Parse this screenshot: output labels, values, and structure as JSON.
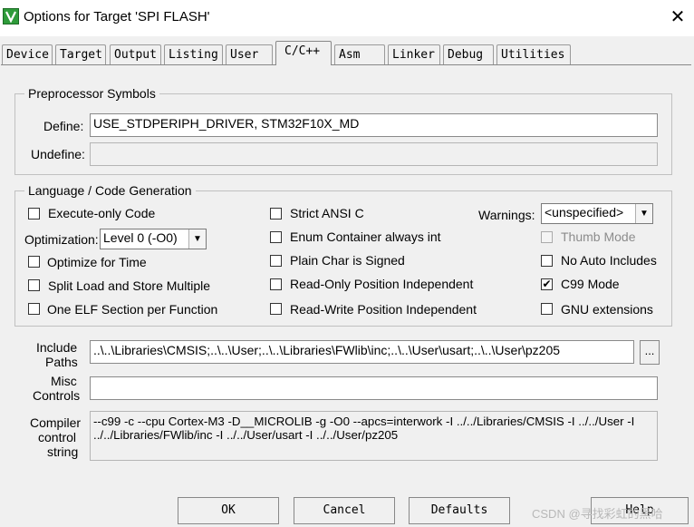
{
  "window": {
    "title": "Options for Target 'SPI FLASH'",
    "close_glyph": "✕",
    "icon": "keil-vision-icon"
  },
  "tabs": [
    "Device",
    "Target",
    "Output",
    "Listing",
    "User",
    "C/C++",
    "Asm",
    "Linker",
    "Debug",
    "Utilities"
  ],
  "active_tab": "C/C++",
  "preprocessor": {
    "group_label": "Preprocessor Symbols",
    "define_label": "Define:",
    "define_value": "USE_STDPERIPH_DRIVER, STM32F10X_MD",
    "undefine_label": "Undefine:",
    "undefine_value": ""
  },
  "codegen": {
    "group_label": "Language / Code Generation",
    "execute_only": {
      "label": "Execute-only Code",
      "checked": false
    },
    "optimization_label": "Optimization:",
    "optimization_value": "Level 0 (-O0)",
    "optimize_for_time": {
      "label": "Optimize for Time",
      "checked": false
    },
    "split_load_store": {
      "label": "Split Load and Store Multiple",
      "checked": false
    },
    "one_elf_section": {
      "label": "One ELF Section per Function",
      "checked": false
    },
    "strict_ansi": {
      "label": "Strict ANSI C",
      "checked": false
    },
    "enum_container": {
      "label": "Enum Container always int",
      "checked": false
    },
    "plain_char_signed": {
      "label": "Plain Char is Signed",
      "checked": false
    },
    "ro_position_independent": {
      "label": "Read-Only Position Independent",
      "checked": false
    },
    "rw_position_independent": {
      "label": "Read-Write Position Independent",
      "checked": false
    },
    "warnings_label": "Warnings:",
    "warnings_value": "<unspecified>",
    "thumb_mode": {
      "label": "Thumb Mode",
      "checked": false,
      "disabled": true
    },
    "no_auto_includes": {
      "label": "No Auto Includes",
      "checked": false
    },
    "c99_mode": {
      "label": "C99 Mode",
      "checked": true
    },
    "gnu_extensions": {
      "label": "GNU extensions",
      "checked": false
    }
  },
  "include_paths": {
    "label_line1": "Include",
    "label_line2": "Paths",
    "value": "..\\..\\Libraries\\CMSIS;..\\..\\User;..\\..\\Libraries\\FWlib\\inc;..\\..\\User\\usart;..\\..\\User\\pz205",
    "browse_label": "..."
  },
  "misc_controls": {
    "label_line1": "Misc",
    "label_line2": "Controls",
    "value": ""
  },
  "compiler_control": {
    "label_line1": "Compiler",
    "label_line2": "control",
    "label_line3": "string",
    "line1": "--c99 -c --cpu Cortex-M3 -D__MICROLIB -g -O0 --apcs=interwork -I ../../Libraries/CMSIS -I ../../User -I",
    "line2": "../../Libraries/FWlib/inc -I ../../User/usart -I ../../User/pz205"
  },
  "buttons": {
    "ok": "OK",
    "cancel": "Cancel",
    "defaults": "Defaults",
    "help": "Help"
  },
  "watermark": "CSDN @寻找彩虹的黑哈"
}
